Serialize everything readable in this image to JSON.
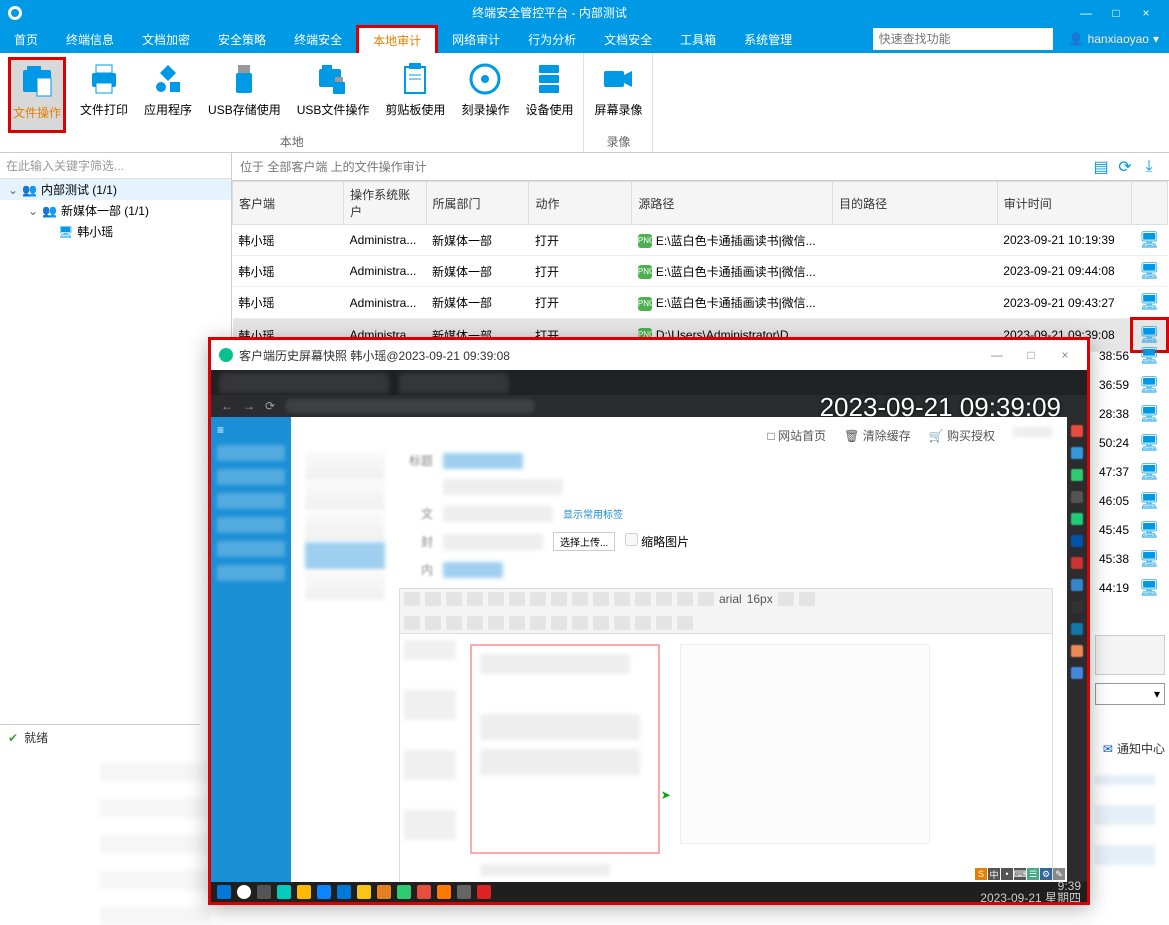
{
  "window": {
    "title": "终端安全管控平台 - 内部测试",
    "min": "—",
    "max": "□",
    "close": "×"
  },
  "menu": {
    "items": [
      "首页",
      "终端信息",
      "文档加密",
      "安全策略",
      "终端安全",
      "本地审计",
      "网络审计",
      "行为分析",
      "文档安全",
      "工具箱",
      "系统管理"
    ],
    "selected_index": 5,
    "search_placeholder": "快速查找功能",
    "user": "hanxiaoyao"
  },
  "ribbon": {
    "groups": [
      {
        "label": "本地",
        "buttons": [
          "文件操作",
          "文件打印",
          "应用程序",
          "USB存储使用",
          "USB文件操作",
          "剪贴板使用",
          "刻录操作",
          "设备使用"
        ],
        "selected": 0
      },
      {
        "label": "录像",
        "buttons": [
          "屏幕录像"
        ]
      }
    ]
  },
  "tree": {
    "filter_placeholder": "在此输入关键字筛选...",
    "root": "内部测试 (1/1)",
    "dept": "新媒体一部 (1/1)",
    "client": "韩小瑶"
  },
  "location_bar": "位于 全部客户端 上的文件操作审计",
  "table": {
    "headers": [
      "客户端",
      "操作系统账户",
      "所属部门",
      "动作",
      "源路径",
      "目的路径",
      "审计时间",
      ""
    ],
    "rows": [
      {
        "c": "韩小瑶",
        "os": "Administra...",
        "d": "新媒体一部",
        "a": "打开",
        "src": "E:\\蓝白色卡通插画读书|微信...",
        "dst": "",
        "t": "2023-09-21 10:19:39"
      },
      {
        "c": "韩小瑶",
        "os": "Administra...",
        "d": "新媒体一部",
        "a": "打开",
        "src": "E:\\蓝白色卡通插画读书|微信...",
        "dst": "",
        "t": "2023-09-21 09:44:08"
      },
      {
        "c": "韩小瑶",
        "os": "Administra...",
        "d": "新媒体一部",
        "a": "打开",
        "src": "E:\\蓝白色卡通插画读书|微信...",
        "dst": "",
        "t": "2023-09-21 09:43:27"
      },
      {
        "c": "韩小瑶",
        "os": "Administra...",
        "d": "新媒体一部",
        "a": "打开",
        "src": "D:\\Users\\Administrator\\D...",
        "dst": "",
        "t": "2023-09-21 09:39:08",
        "hl": true
      }
    ],
    "extra_times": [
      "38:56",
      "36:59",
      "28:38",
      "50:24",
      "47:37",
      "46:05",
      "45:45",
      "45:38",
      "44:19"
    ]
  },
  "status": "就绪",
  "notify": "通知中心",
  "popup": {
    "title": "客户端历史屏幕快照 韩小瑶@2023-09-21 09:39:08",
    "min": "—",
    "max": "□",
    "close": "×",
    "timestamp_overlay": "2023-09-21 09:39:09",
    "page_top": {
      "a": "网站首页",
      "b": "清除缓存",
      "c": "购买授权"
    },
    "form": {
      "link": "显示常用标签",
      "btn": "选择上传...",
      "chk": "缩略图片"
    },
    "taskbar_time": "9:39",
    "taskbar_date": "2023-09-21 星期四",
    "ime": "中"
  }
}
